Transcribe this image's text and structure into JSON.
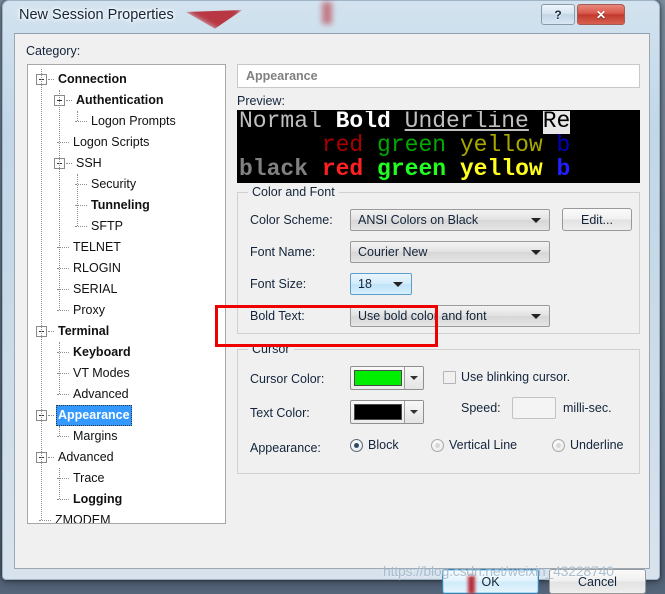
{
  "window": {
    "title": "New Session Properties",
    "help_button": "?",
    "close_button": "✕"
  },
  "category": {
    "label": "Category:",
    "items": [
      {
        "label": "Connection",
        "depth": 0,
        "bold": true,
        "expander": true,
        "selected": false
      },
      {
        "label": "Authentication",
        "depth": 1,
        "bold": true,
        "expander": true,
        "selected": false
      },
      {
        "label": "Logon Prompts",
        "depth": 2,
        "bold": false,
        "expander": false,
        "selected": false
      },
      {
        "label": "Logon Scripts",
        "depth": 1,
        "bold": false,
        "expander": false,
        "selected": false
      },
      {
        "label": "SSH",
        "depth": 1,
        "bold": false,
        "expander": true,
        "selected": false
      },
      {
        "label": "Security",
        "depth": 2,
        "bold": false,
        "expander": false,
        "selected": false
      },
      {
        "label": "Tunneling",
        "depth": 2,
        "bold": true,
        "expander": false,
        "selected": false
      },
      {
        "label": "SFTP",
        "depth": 2,
        "bold": false,
        "expander": false,
        "selected": false
      },
      {
        "label": "TELNET",
        "depth": 1,
        "bold": false,
        "expander": false,
        "selected": false
      },
      {
        "label": "RLOGIN",
        "depth": 1,
        "bold": false,
        "expander": false,
        "selected": false
      },
      {
        "label": "SERIAL",
        "depth": 1,
        "bold": false,
        "expander": false,
        "selected": false
      },
      {
        "label": "Proxy",
        "depth": 1,
        "bold": false,
        "expander": false,
        "selected": false
      },
      {
        "label": "Terminal",
        "depth": 0,
        "bold": true,
        "expander": true,
        "selected": false
      },
      {
        "label": "Keyboard",
        "depth": 1,
        "bold": true,
        "expander": false,
        "selected": false
      },
      {
        "label": "VT Modes",
        "depth": 1,
        "bold": false,
        "expander": false,
        "selected": false
      },
      {
        "label": "Advanced",
        "depth": 1,
        "bold": false,
        "expander": false,
        "selected": false
      },
      {
        "label": "Appearance",
        "depth": 0,
        "bold": true,
        "expander": true,
        "selected": true
      },
      {
        "label": "Margins",
        "depth": 1,
        "bold": false,
        "expander": false,
        "selected": false
      },
      {
        "label": "Advanced",
        "depth": 0,
        "bold": false,
        "expander": true,
        "selected": false
      },
      {
        "label": "Trace",
        "depth": 1,
        "bold": false,
        "expander": false,
        "selected": false
      },
      {
        "label": "Logging",
        "depth": 1,
        "bold": true,
        "expander": false,
        "selected": false
      },
      {
        "label": "ZMODEM",
        "depth": 0,
        "bold": false,
        "expander": false,
        "selected": false
      }
    ]
  },
  "page": {
    "header": "Appearance",
    "preview_label": "Preview:",
    "preview": {
      "background": "#000000",
      "lines": [
        {
          "segments": [
            {
              "text": "Normal ",
              "style": "normal",
              "color": "#c0c0c0"
            },
            {
              "text": "Bold ",
              "style": "bold",
              "color": "#ffffff"
            },
            {
              "text": "Underline ",
              "style": "underline",
              "color": "#c0c0c0"
            },
            {
              "text": "Re",
              "style": "reverse",
              "color": "#000000"
            }
          ]
        },
        {
          "segments": [
            {
              "text": "      ",
              "style": "normal",
              "color": "#000000"
            },
            {
              "text": "red ",
              "style": "normal",
              "color": "#a80000"
            },
            {
              "text": "green ",
              "style": "normal",
              "color": "#00a800"
            },
            {
              "text": "yellow ",
              "style": "normal",
              "color": "#a8a800"
            },
            {
              "text": "b",
              "style": "normal",
              "color": "#0000c0"
            }
          ]
        },
        {
          "segments": [
            {
              "text": "black ",
              "style": "bold",
              "color": "#808080"
            },
            {
              "text": "red ",
              "style": "bold",
              "color": "#ff2020"
            },
            {
              "text": "green ",
              "style": "bold",
              "color": "#20ff20"
            },
            {
              "text": "yellow ",
              "style": "bold",
              "color": "#ffff20"
            },
            {
              "text": "b",
              "style": "bold",
              "color": "#2020ff"
            }
          ]
        }
      ]
    }
  },
  "color_and_font": {
    "title": "Color and Font",
    "color_scheme_label": "Color Scheme:",
    "color_scheme_value": "ANSI Colors on Black",
    "edit_button": "Edit...",
    "font_name_label": "Font Name:",
    "font_name_value": "Courier New",
    "font_size_label": "Font Size:",
    "font_size_value": "18",
    "bold_text_label": "Bold Text:",
    "bold_text_value": "Use bold color and font"
  },
  "cursor": {
    "title": "Cursor",
    "cursor_color_label": "Cursor Color:",
    "cursor_color_value": "#00ee00",
    "text_color_label": "Text Color:",
    "text_color_value": "#000000",
    "blinking_label": "Use blinking cursor.",
    "blinking_checked": false,
    "speed_label": "Speed:",
    "speed_value": "",
    "speed_units": "milli-sec.",
    "appearance_label": "Appearance:",
    "appearance_options": [
      {
        "label": "Block",
        "selected": true
      },
      {
        "label": "Vertical Line",
        "selected": false
      },
      {
        "label": "Underline",
        "selected": false
      }
    ]
  },
  "footer": {
    "ok_button": "OK",
    "cancel_button": "Cancel"
  },
  "watermark": {
    "text": "https://blog.csdn.net/weixin_43228740"
  },
  "colors": {
    "accent": "#3399ff",
    "highlight_box": "#ee0000",
    "close_button": "#c13a2d",
    "cursor_green": "#00ee00"
  }
}
